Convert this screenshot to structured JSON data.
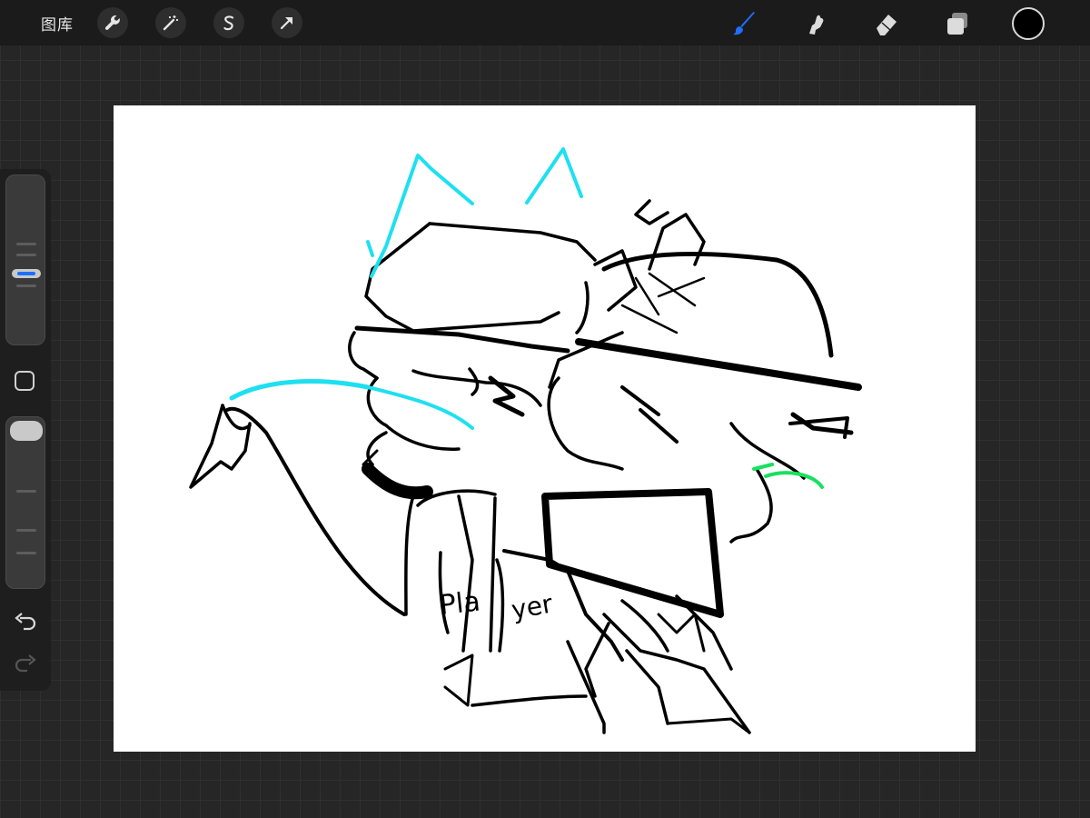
{
  "topbar": {
    "gallery_label": "图库",
    "left_tools": [
      "wrench-icon",
      "magic-wand-icon",
      "selection-icon",
      "transform-arrow-icon"
    ],
    "right_tools": [
      "brush-icon",
      "smudge-icon",
      "eraser-icon",
      "layers-icon"
    ],
    "active_tool": "brush",
    "active_color": "#1e6fff",
    "current_color": "#000000"
  },
  "sidebar": {
    "brush_size_level": 0.5,
    "opacity_level": 0.0,
    "buttons": [
      "modify-button",
      "undo-button",
      "redo-button"
    ]
  },
  "canvas": {
    "background": "#ffffff",
    "stroke_colors": [
      "#000000",
      "#1ee0f0",
      "#18e060"
    ],
    "text_marks": [
      "Pla",
      "yer"
    ]
  }
}
